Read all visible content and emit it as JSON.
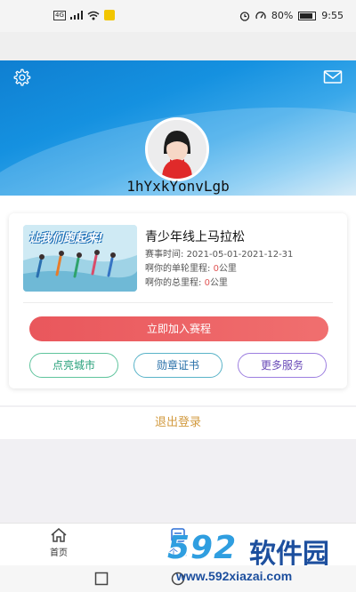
{
  "status_bar": {
    "network_tag": "4G",
    "battery": "80%",
    "time": "9:55"
  },
  "profile": {
    "username": "1hYxkYonvLgb"
  },
  "race": {
    "title": "青少年线上马拉松",
    "date_label": "赛事时间: ",
    "date_value": "2021-05-01-2021-12-31",
    "single_label": "啊你的单轮里程: ",
    "single_value": "0",
    "total_label": "啊你的总里程: ",
    "total_value": "0",
    "unit": "公里",
    "image_text": "让我们跑起来!"
  },
  "actions": {
    "join": "立即加入赛程",
    "light_city": "点亮城市",
    "medal_cert": "勋章证书",
    "more_services": "更多服务",
    "logout": "退出登录"
  },
  "bottom_nav": {
    "home": "首页",
    "me": "个人"
  },
  "watermark": {
    "number": "592",
    "name": "软件园",
    "url": "www.592xiazai.com"
  },
  "colors": {
    "accent_red": "#e9575c",
    "city_green": "#27a07a",
    "cert_blue": "#276fa8",
    "more_purple": "#6a4bb8",
    "logout_gold": "#d29a3f",
    "nav_active": "#2b6fd6"
  },
  "icons": {
    "settings": "gear-icon",
    "mail": "mail-icon",
    "home": "home-icon",
    "me": "profile-icon"
  }
}
